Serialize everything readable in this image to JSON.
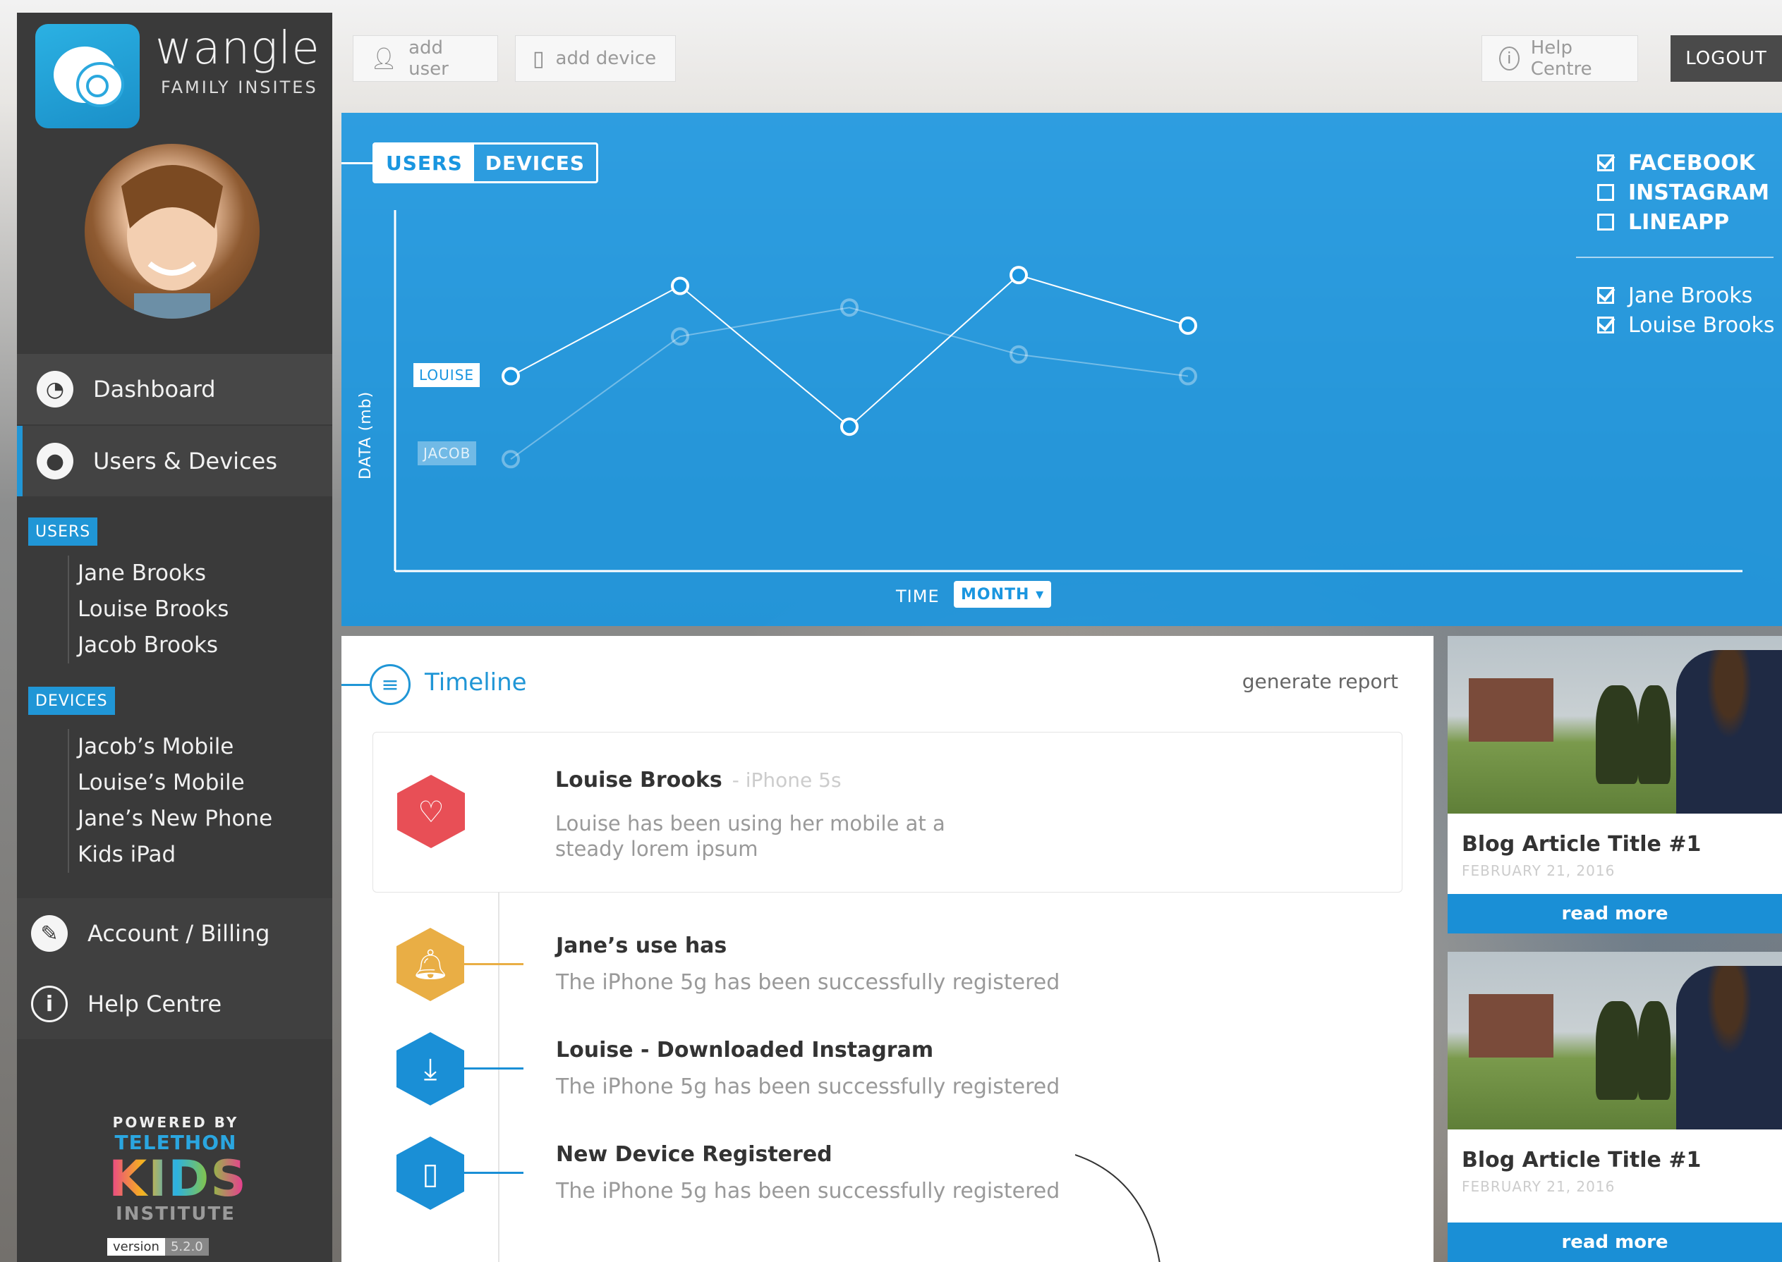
{
  "brand": {
    "name": "wangle",
    "tagline": "FAMILY INSITES"
  },
  "toolbar": {
    "add_user": "add user",
    "add_device": "add device",
    "help": "Help Centre",
    "logout": "LOGOUT"
  },
  "sidebar": {
    "dashboard": "Dashboard",
    "users_devices": "Users & Devices",
    "users_label": "USERS",
    "users": [
      "Jane Brooks",
      "Louise Brooks",
      "Jacob Brooks"
    ],
    "devices_label": "DEVICES",
    "devices": [
      "Jacob’s Mobile",
      "Louise’s Mobile",
      "Jane’s New Phone",
      "Kids iPad"
    ],
    "account": "Account / Billing",
    "help": "Help Centre",
    "powered": "POWERED BY",
    "telethon": "TELETHON",
    "kids": "KIDS",
    "institute": "INSTITUTE",
    "version_label": "version",
    "version_value": "5.2.0"
  },
  "chart": {
    "toggle_users": "USERS",
    "toggle_devices": "DEVICES",
    "filters_apps": [
      {
        "label": "FACEBOOK",
        "checked": true
      },
      {
        "label": "INSTAGRAM",
        "checked": false
      },
      {
        "label": "LINEAPP",
        "checked": false
      }
    ],
    "filters_users": [
      {
        "label": "Jane Brooks",
        "checked": true
      },
      {
        "label": "Louise Brooks",
        "checked": true
      }
    ],
    "ylabel": "DATA (mb)",
    "time_label": "TIME",
    "period": "MONTH ▾",
    "accent": "#1a96e0"
  },
  "chart_data": {
    "type": "line",
    "title": "",
    "xlabel": "TIME",
    "ylabel": "DATA (mb)",
    "ylim": [
      0,
      100
    ],
    "x": [
      1,
      2,
      3,
      4,
      5,
      6
    ],
    "series": [
      {
        "name": "LOUISE",
        "values": [
          54,
          79,
          40,
          82,
          68
        ]
      },
      {
        "name": "JACOB",
        "values": [
          31,
          65,
          73,
          60,
          54
        ]
      }
    ]
  },
  "timeline": {
    "title": "Timeline",
    "report": "generate report",
    "events": [
      {
        "title": "Louise Brooks",
        "device": "- iPhone 5s",
        "text1": "Louise has been using her mobile at a",
        "text2": "steady lorem ipsum",
        "icon": "heart-icon",
        "color": "#e84f56"
      },
      {
        "title": "Jane’s use has",
        "text": "The iPhone 5g has been successfully registered",
        "icon": "bell-icon",
        "color": "#e9ae45"
      },
      {
        "title": "Louise - Downloaded Instagram",
        "text": "The iPhone 5g has been successfully registered",
        "icon": "download-icon",
        "color": "#1a8fd6"
      },
      {
        "title": "New Device Registered",
        "text": "The iPhone 5g has been successfully registered",
        "icon": "phone-icon",
        "color": "#1a8fd6"
      }
    ]
  },
  "blog": [
    {
      "title": "Blog Article Title #1",
      "date": "FEBRUARY 21, 2016",
      "button": "read more"
    },
    {
      "title": "Blog Article Title #1",
      "date": "FEBRUARY 21, 2016",
      "button": "read more"
    }
  ]
}
